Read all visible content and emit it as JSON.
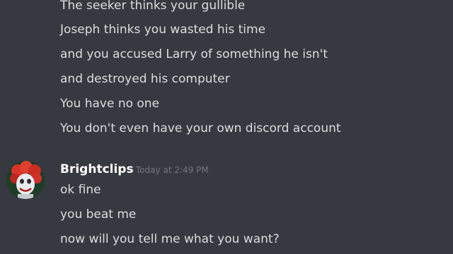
{
  "messages_previous": [
    "The seeker thinks your gullible",
    "Joseph thinks you wasted his time",
    "and you accused Larry of something he isn't",
    "and destroyed his computer",
    "You have no one",
    "You don't even have your own discord account"
  ],
  "group": {
    "username": "Brightclips",
    "timestamp": "Today at 2:49 PM",
    "avatar_icon": "avatar-icon",
    "messages": [
      "ok fine",
      "you beat me",
      "now will you tell me what you want?"
    ]
  },
  "colors": {
    "background": "#36393f",
    "message_text": "#dcddde",
    "username": "#ffffff",
    "timestamp": "#72767d"
  }
}
